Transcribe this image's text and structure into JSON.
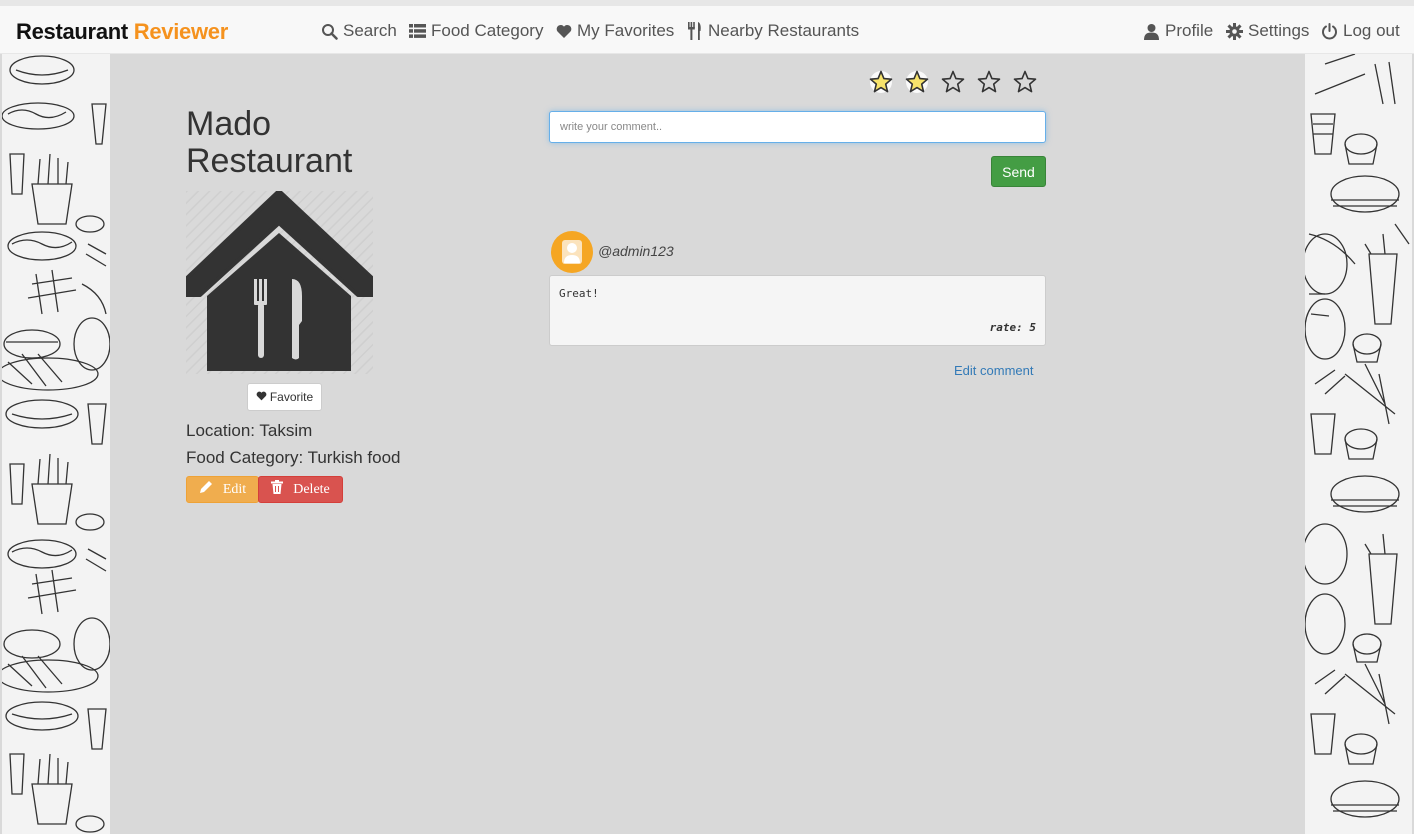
{
  "navbar": {
    "brand_part1": "Restaurant",
    "brand_part2": "Reviewer",
    "items": [
      {
        "label": "Search",
        "icon": "search-icon"
      },
      {
        "label": "Food Category",
        "icon": "list-icon"
      },
      {
        "label": "My Favorites",
        "icon": "heart-icon"
      },
      {
        "label": "Nearby Restaurants",
        "icon": "cutlery-icon"
      }
    ],
    "right_items": [
      {
        "label": "Profile",
        "icon": "user-icon"
      },
      {
        "label": "Settings",
        "icon": "gear-icon"
      },
      {
        "label": "Log out",
        "icon": "power-icon"
      }
    ]
  },
  "restaurant": {
    "name_line1": "Mado",
    "name_line2": "Restaurant",
    "favorite_label": "Favorite",
    "location": "Location: Taksim",
    "food_category": "Food Category: Turkish food",
    "edit_label": "Edit",
    "delete_label": "Delete"
  },
  "rating": {
    "selected": 2,
    "max": 5
  },
  "comment_form": {
    "placeholder": "write your comment..",
    "send_label": "Send"
  },
  "comments": [
    {
      "username": "@admin123",
      "text": "Great!",
      "rate_text": "rate: 5",
      "edit_label": "Edit comment"
    }
  ],
  "colors": {
    "brand_accent": "#f5921e",
    "edit": "#f0ad4e",
    "delete": "#d9534f",
    "send": "#449d44",
    "star_filled": "#f7e36b",
    "link": "#337ab7"
  }
}
